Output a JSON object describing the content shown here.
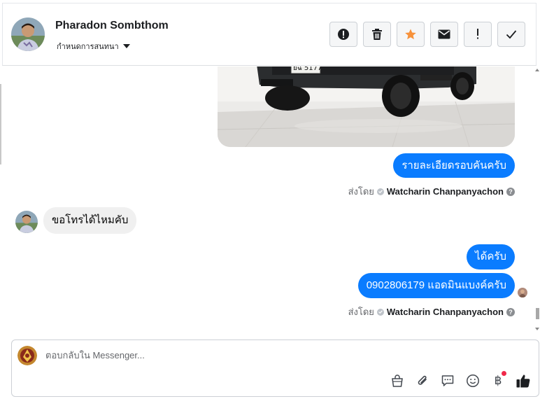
{
  "header": {
    "name": "Pharadon Sombthom",
    "assign_label": "กำหนดการสนทนา"
  },
  "toolbar": [
    {
      "icon": "alert-circle-icon"
    },
    {
      "icon": "trash-icon"
    },
    {
      "icon": "star-icon",
      "color": "#f7923b"
    },
    {
      "icon": "envelope-icon"
    },
    {
      "icon": "exclamation-icon"
    },
    {
      "icon": "checkmark-icon"
    }
  ],
  "messages": [
    {
      "kind": "image",
      "desc": "truck-photo",
      "plate": "ยฉ 5177"
    },
    {
      "kind": "outgoing",
      "text": "รายละเอียดรอบคันครับ"
    },
    {
      "kind": "sent_by",
      "prefix": "ส่งโดย",
      "agent": "Watcharin Chanpanyachon"
    },
    {
      "kind": "incoming",
      "text": "ขอโทรได้ไหมคับ"
    },
    {
      "kind": "outgoing",
      "text": "ได้ครับ"
    },
    {
      "kind": "outgoing",
      "text": "0902806179 แอดมินแบงค์ครับ"
    },
    {
      "kind": "sent_by",
      "prefix": "ส่งโดย",
      "agent": "Watcharin Chanpanyachon"
    }
  ],
  "composer": {
    "placeholder": "ตอบกลับใน Messenger...",
    "tools": [
      "bag-icon",
      "paperclip-icon",
      "saved-reply-icon",
      "emoji-icon",
      "baht-payment-icon",
      "thumbs-up-icon"
    ],
    "baht_symbol": "฿",
    "accent_color": "#0a7cff"
  }
}
